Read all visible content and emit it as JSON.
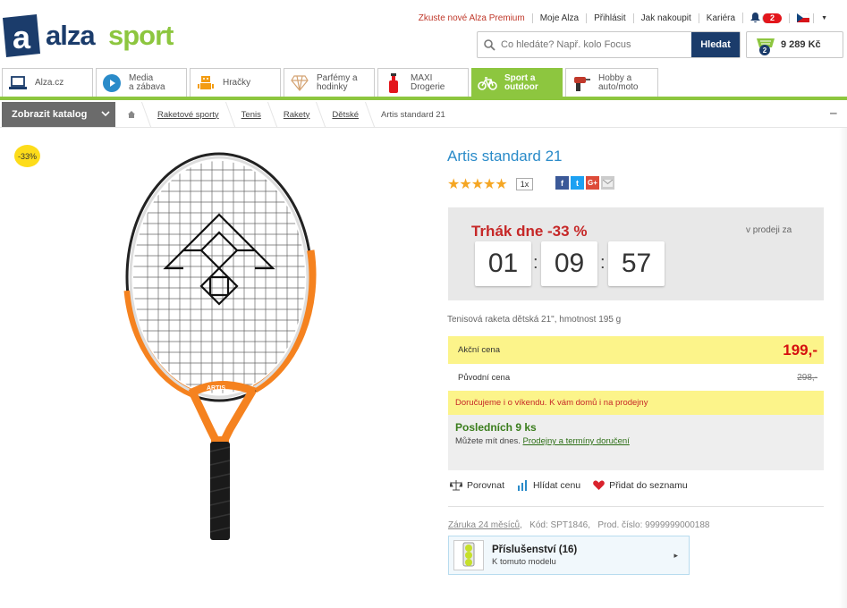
{
  "header": {
    "logo_text": "alza sport",
    "top_links": [
      "Zkuste nové Alza Premium",
      "Moje Alza",
      "Přihlásit",
      "Jak nakoupit",
      "Kariéra"
    ],
    "notifications_count": "2",
    "search": {
      "placeholder": "Co hledáte? Např. kolo Focus",
      "button": "Hledat"
    },
    "cart": {
      "count": "2",
      "total": "9 289 Kč"
    }
  },
  "tabs": [
    {
      "label": "Alza.cz",
      "icon": "laptop-icon"
    },
    {
      "label": "Media\na zábava",
      "icon": "play-icon"
    },
    {
      "label": "Hračky",
      "icon": "robot-icon"
    },
    {
      "label": "Parfémy a\nhodinky",
      "icon": "diamond-icon"
    },
    {
      "label": "MAXI\nDrogerie",
      "icon": "bottle-icon"
    },
    {
      "label": "Sport a\noutdoor",
      "icon": "bicycle-icon",
      "active": true
    },
    {
      "label": "Hobby a\nauto/moto",
      "icon": "drill-icon"
    }
  ],
  "catalog_button": "Zobrazit katalog",
  "breadcrumb": [
    "Raketové sporty",
    "Tenis",
    "Rakety",
    "Dětské",
    "Artis standard 21"
  ],
  "product": {
    "discount_badge": "-33%",
    "title": "Artis standard 21",
    "rating_stars": 5,
    "rating_count": "1x",
    "deal": {
      "title": "Trhák dne -33 %",
      "sale_label": "v prodeji za",
      "hours": "01",
      "minutes": "09",
      "seconds": "57"
    },
    "description": "Tenisová raketa dětská 21\", hmotnost 195 g",
    "action_price_label": "Akční cena",
    "action_price": "199,-",
    "original_price_label": "Původní cena",
    "original_price": "298,-",
    "delivery_notice": "Doručujeme i o víkendu. K vám domů i na prodejny",
    "stock_title": "Posledních 9 ks",
    "stock_text": "Můžete mít dnes.",
    "stock_link": "Prodejny a termíny doručení",
    "actions": [
      "Porovnat",
      "Hlídat cenu",
      "Přidat do seznamu"
    ],
    "warranty": "Záruka 24 měsíců",
    "code": "Kód: SPT1846,",
    "product_number": "Prod. číslo: 9999999000188",
    "accessories_title": "Příslušenství (16)",
    "accessories_sub": "K tomuto modelu"
  },
  "colors": {
    "brand_green": "#8dc63f",
    "brand_blue": "#1b3c6b",
    "title_blue": "#2a8bc9",
    "deal_red": "#c62828",
    "badge_yellow": "#fddc1a"
  }
}
